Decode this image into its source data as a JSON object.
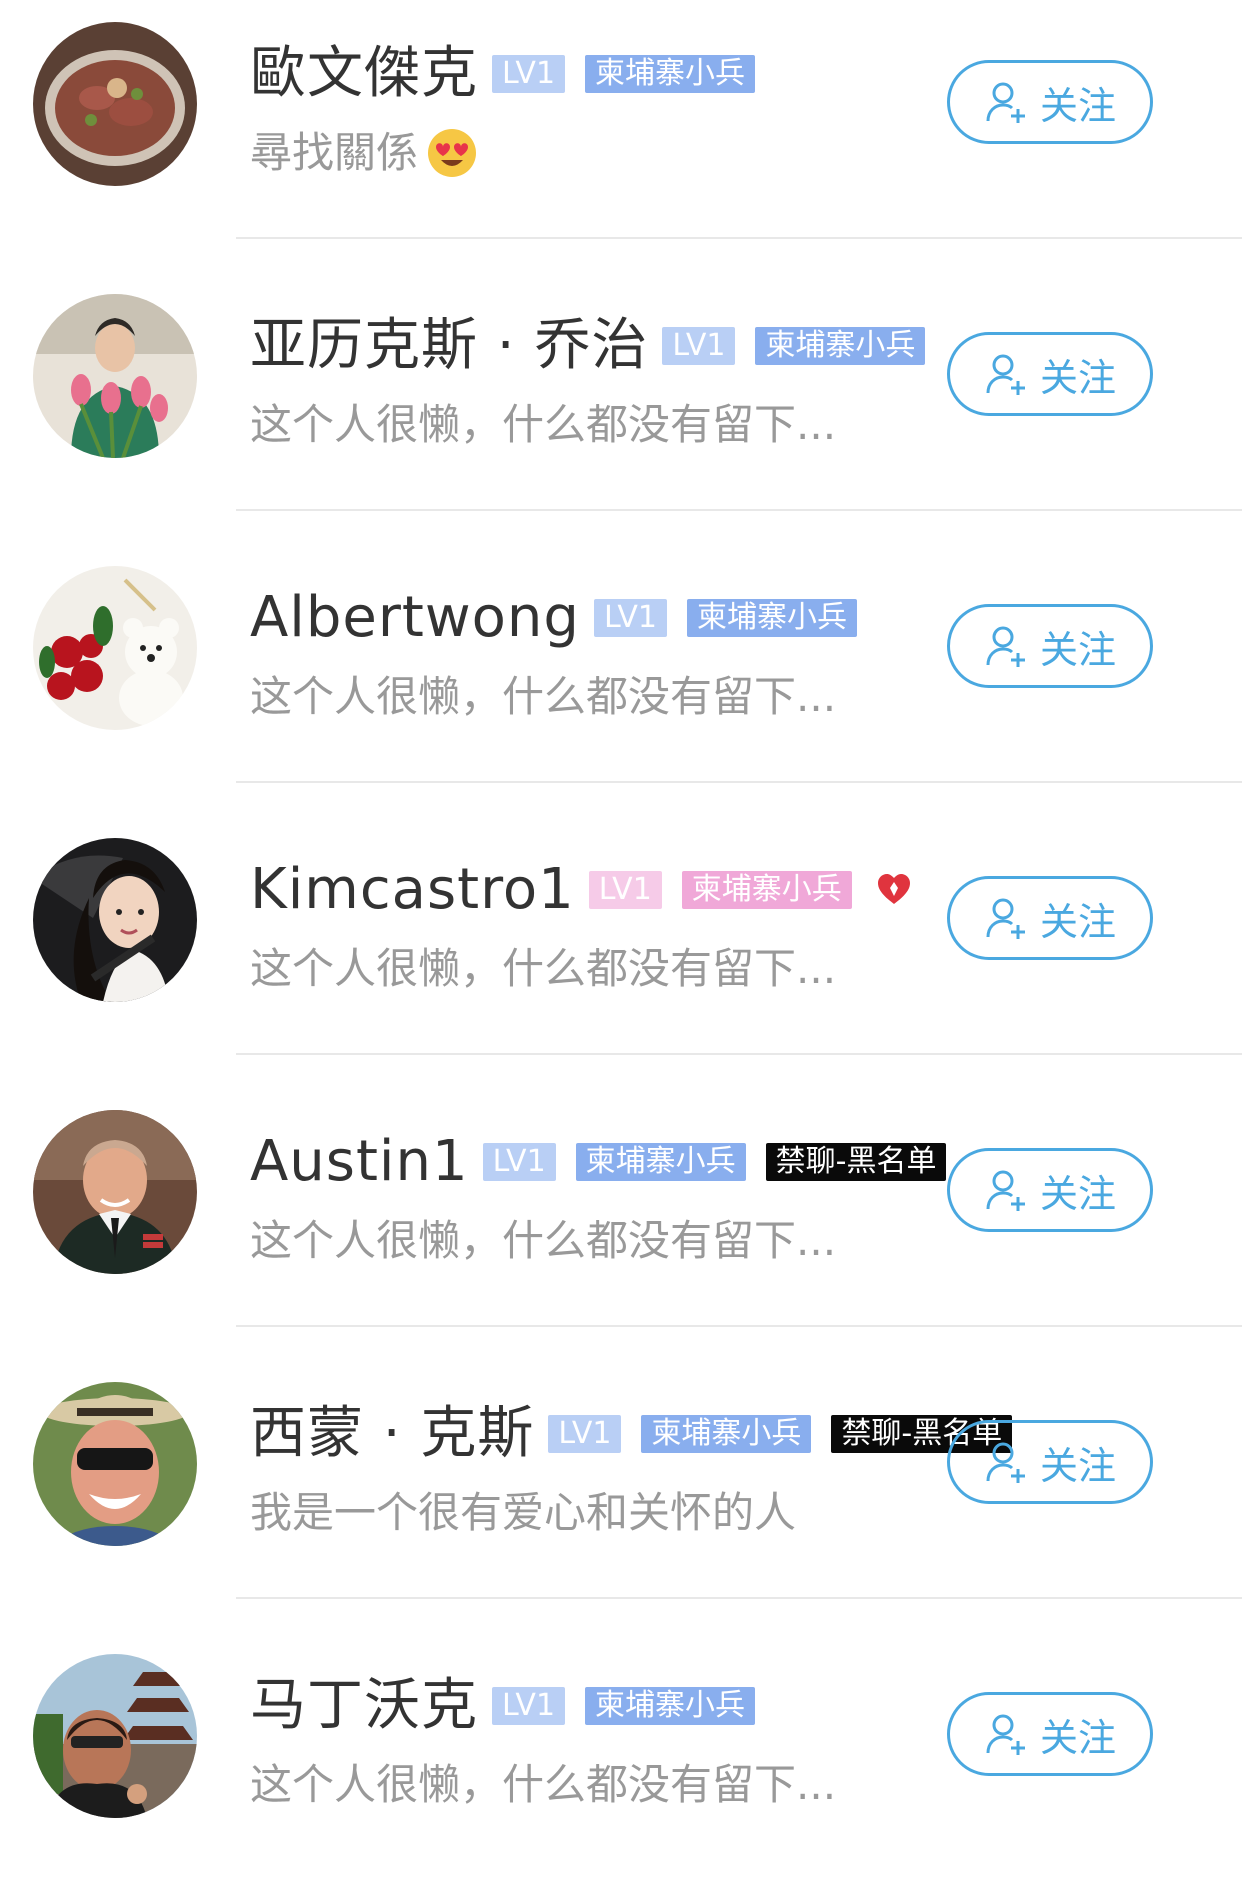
{
  "follow_label": "关注",
  "colors": {
    "accent": "#4aa8e0",
    "tag_blue": "#89aeee",
    "tag_blue_light": "#b9cff5",
    "tag_pink": "#f0a8d8",
    "tag_pink_light": "#f6cbe8",
    "heart": "#e0343e"
  },
  "users": [
    {
      "name": "歐文傑克",
      "level": "LV1",
      "rank": "柬埔寨小兵",
      "bio": "尋找關係",
      "bio_emoji": "heart-eyes-emoji",
      "gender": "male"
    },
    {
      "name": "亚历克斯 · 乔治",
      "level": "LV1",
      "rank": "柬埔寨小兵",
      "bio": "这个人很懒，什么都没有留下...",
      "gender": "male"
    },
    {
      "name": "Albertwong",
      "level": "LV1",
      "rank": "柬埔寨小兵",
      "bio": "这个人很懒，什么都没有留下...",
      "gender": "male"
    },
    {
      "name": "Kimcastro1",
      "level": "LV1",
      "rank": "柬埔寨小兵",
      "bio": "这个人很懒，什么都没有留下...",
      "gender": "female",
      "badge_icon": "heart-icon"
    },
    {
      "name": "Austin1",
      "level": "LV1",
      "rank": "柬埔寨小兵",
      "ban_tag": "禁聊-黑名单",
      "bio": "这个人很懒，什么都没有留下...",
      "gender": "male"
    },
    {
      "name": "西蒙 · 克斯",
      "level": "LV1",
      "rank": "柬埔寨小兵",
      "ban_tag": "禁聊-黑名单",
      "bio": "我是一个很有爱心和关怀的人",
      "gender": "male"
    },
    {
      "name": "马丁沃克",
      "level": "LV1",
      "rank": "柬埔寨小兵",
      "bio": "这个人很懒，什么都没有留下...",
      "gender": "male"
    }
  ]
}
